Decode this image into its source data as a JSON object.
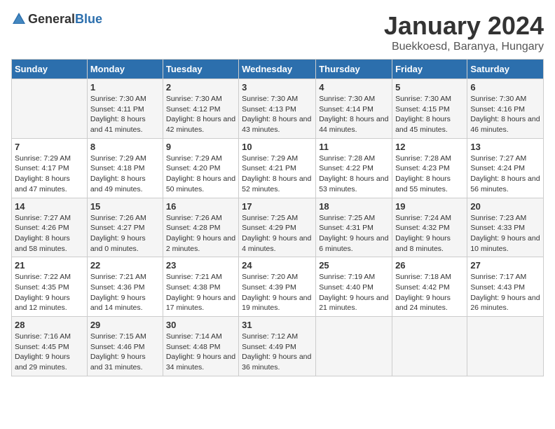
{
  "logo": {
    "text_general": "General",
    "text_blue": "Blue"
  },
  "title": "January 2024",
  "location": "Buekkoesd, Baranya, Hungary",
  "weekdays": [
    "Sunday",
    "Monday",
    "Tuesday",
    "Wednesday",
    "Thursday",
    "Friday",
    "Saturday"
  ],
  "weeks": [
    [
      {
        "day": "",
        "sunrise": "",
        "sunset": "",
        "daylight": ""
      },
      {
        "day": "1",
        "sunrise": "Sunrise: 7:30 AM",
        "sunset": "Sunset: 4:11 PM",
        "daylight": "Daylight: 8 hours and 41 minutes."
      },
      {
        "day": "2",
        "sunrise": "Sunrise: 7:30 AM",
        "sunset": "Sunset: 4:12 PM",
        "daylight": "Daylight: 8 hours and 42 minutes."
      },
      {
        "day": "3",
        "sunrise": "Sunrise: 7:30 AM",
        "sunset": "Sunset: 4:13 PM",
        "daylight": "Daylight: 8 hours and 43 minutes."
      },
      {
        "day": "4",
        "sunrise": "Sunrise: 7:30 AM",
        "sunset": "Sunset: 4:14 PM",
        "daylight": "Daylight: 8 hours and 44 minutes."
      },
      {
        "day": "5",
        "sunrise": "Sunrise: 7:30 AM",
        "sunset": "Sunset: 4:15 PM",
        "daylight": "Daylight: 8 hours and 45 minutes."
      },
      {
        "day": "6",
        "sunrise": "Sunrise: 7:30 AM",
        "sunset": "Sunset: 4:16 PM",
        "daylight": "Daylight: 8 hours and 46 minutes."
      }
    ],
    [
      {
        "day": "7",
        "sunrise": "Sunrise: 7:29 AM",
        "sunset": "Sunset: 4:17 PM",
        "daylight": "Daylight: 8 hours and 47 minutes."
      },
      {
        "day": "8",
        "sunrise": "Sunrise: 7:29 AM",
        "sunset": "Sunset: 4:18 PM",
        "daylight": "Daylight: 8 hours and 49 minutes."
      },
      {
        "day": "9",
        "sunrise": "Sunrise: 7:29 AM",
        "sunset": "Sunset: 4:20 PM",
        "daylight": "Daylight: 8 hours and 50 minutes."
      },
      {
        "day": "10",
        "sunrise": "Sunrise: 7:29 AM",
        "sunset": "Sunset: 4:21 PM",
        "daylight": "Daylight: 8 hours and 52 minutes."
      },
      {
        "day": "11",
        "sunrise": "Sunrise: 7:28 AM",
        "sunset": "Sunset: 4:22 PM",
        "daylight": "Daylight: 8 hours and 53 minutes."
      },
      {
        "day": "12",
        "sunrise": "Sunrise: 7:28 AM",
        "sunset": "Sunset: 4:23 PM",
        "daylight": "Daylight: 8 hours and 55 minutes."
      },
      {
        "day": "13",
        "sunrise": "Sunrise: 7:27 AM",
        "sunset": "Sunset: 4:24 PM",
        "daylight": "Daylight: 8 hours and 56 minutes."
      }
    ],
    [
      {
        "day": "14",
        "sunrise": "Sunrise: 7:27 AM",
        "sunset": "Sunset: 4:26 PM",
        "daylight": "Daylight: 8 hours and 58 minutes."
      },
      {
        "day": "15",
        "sunrise": "Sunrise: 7:26 AM",
        "sunset": "Sunset: 4:27 PM",
        "daylight": "Daylight: 9 hours and 0 minutes."
      },
      {
        "day": "16",
        "sunrise": "Sunrise: 7:26 AM",
        "sunset": "Sunset: 4:28 PM",
        "daylight": "Daylight: 9 hours and 2 minutes."
      },
      {
        "day": "17",
        "sunrise": "Sunrise: 7:25 AM",
        "sunset": "Sunset: 4:29 PM",
        "daylight": "Daylight: 9 hours and 4 minutes."
      },
      {
        "day": "18",
        "sunrise": "Sunrise: 7:25 AM",
        "sunset": "Sunset: 4:31 PM",
        "daylight": "Daylight: 9 hours and 6 minutes."
      },
      {
        "day": "19",
        "sunrise": "Sunrise: 7:24 AM",
        "sunset": "Sunset: 4:32 PM",
        "daylight": "Daylight: 9 hours and 8 minutes."
      },
      {
        "day": "20",
        "sunrise": "Sunrise: 7:23 AM",
        "sunset": "Sunset: 4:33 PM",
        "daylight": "Daylight: 9 hours and 10 minutes."
      }
    ],
    [
      {
        "day": "21",
        "sunrise": "Sunrise: 7:22 AM",
        "sunset": "Sunset: 4:35 PM",
        "daylight": "Daylight: 9 hours and 12 minutes."
      },
      {
        "day": "22",
        "sunrise": "Sunrise: 7:21 AM",
        "sunset": "Sunset: 4:36 PM",
        "daylight": "Daylight: 9 hours and 14 minutes."
      },
      {
        "day": "23",
        "sunrise": "Sunrise: 7:21 AM",
        "sunset": "Sunset: 4:38 PM",
        "daylight": "Daylight: 9 hours and 17 minutes."
      },
      {
        "day": "24",
        "sunrise": "Sunrise: 7:20 AM",
        "sunset": "Sunset: 4:39 PM",
        "daylight": "Daylight: 9 hours and 19 minutes."
      },
      {
        "day": "25",
        "sunrise": "Sunrise: 7:19 AM",
        "sunset": "Sunset: 4:40 PM",
        "daylight": "Daylight: 9 hours and 21 minutes."
      },
      {
        "day": "26",
        "sunrise": "Sunrise: 7:18 AM",
        "sunset": "Sunset: 4:42 PM",
        "daylight": "Daylight: 9 hours and 24 minutes."
      },
      {
        "day": "27",
        "sunrise": "Sunrise: 7:17 AM",
        "sunset": "Sunset: 4:43 PM",
        "daylight": "Daylight: 9 hours and 26 minutes."
      }
    ],
    [
      {
        "day": "28",
        "sunrise": "Sunrise: 7:16 AM",
        "sunset": "Sunset: 4:45 PM",
        "daylight": "Daylight: 9 hours and 29 minutes."
      },
      {
        "day": "29",
        "sunrise": "Sunrise: 7:15 AM",
        "sunset": "Sunset: 4:46 PM",
        "daylight": "Daylight: 9 hours and 31 minutes."
      },
      {
        "day": "30",
        "sunrise": "Sunrise: 7:14 AM",
        "sunset": "Sunset: 4:48 PM",
        "daylight": "Daylight: 9 hours and 34 minutes."
      },
      {
        "day": "31",
        "sunrise": "Sunrise: 7:12 AM",
        "sunset": "Sunset: 4:49 PM",
        "daylight": "Daylight: 9 hours and 36 minutes."
      },
      {
        "day": "",
        "sunrise": "",
        "sunset": "",
        "daylight": ""
      },
      {
        "day": "",
        "sunrise": "",
        "sunset": "",
        "daylight": ""
      },
      {
        "day": "",
        "sunrise": "",
        "sunset": "",
        "daylight": ""
      }
    ]
  ]
}
